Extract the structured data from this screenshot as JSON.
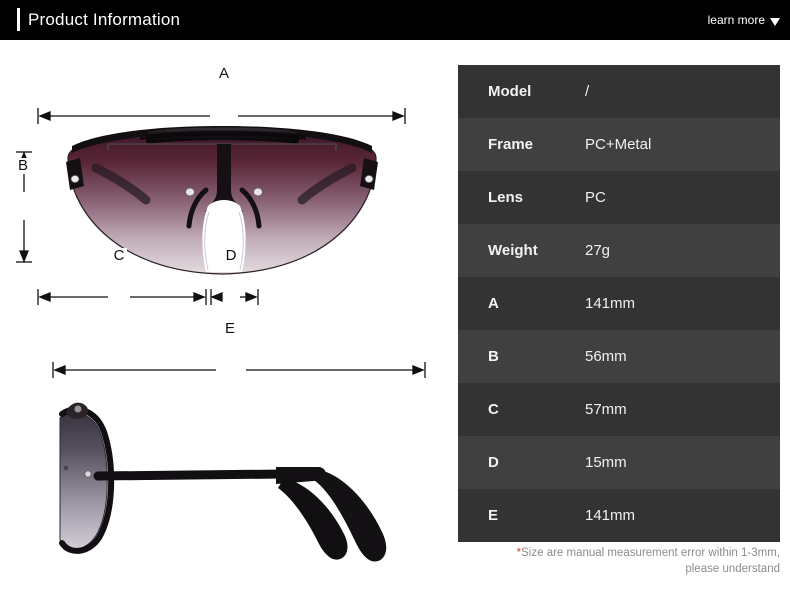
{
  "header": {
    "title": "Product Information",
    "learn_more_label": "learn more",
    "caret_icon": "chevron-down-icon",
    "background_color": "#000000",
    "text_color": "#ffffff"
  },
  "diagram": {
    "front_view": {
      "alt": "sunglasses-front-view",
      "lens_gradient_top": "#4a1f2e",
      "lens_gradient_bottom": "#e4dbe0",
      "frame_color": "#141014"
    },
    "side_view": {
      "alt": "sunglasses-side-view",
      "lens_gradient_top": "#3a3540",
      "lens_gradient_bottom": "#ded8e0",
      "frame_color": "#111111"
    },
    "dimension_labels": [
      {
        "id": "A",
        "label": "A",
        "orientation": "horizontal",
        "view": "front"
      },
      {
        "id": "B",
        "label": "B",
        "orientation": "vertical",
        "view": "front"
      },
      {
        "id": "C",
        "label": "C",
        "orientation": "horizontal",
        "view": "front"
      },
      {
        "id": "D",
        "label": "D",
        "orientation": "horizontal",
        "view": "front"
      },
      {
        "id": "E",
        "label": "E",
        "orientation": "horizontal",
        "view": "side"
      }
    ]
  },
  "spec_table": {
    "row_color_odd": "#333333",
    "row_color_even": "#404040",
    "rows": [
      {
        "key": "Model",
        "value": "/"
      },
      {
        "key": "Frame",
        "value": "PC+Metal"
      },
      {
        "key": "Lens",
        "value": "PC"
      },
      {
        "key": "Weight",
        "value": "27g"
      },
      {
        "key": "A",
        "value": "141mm"
      },
      {
        "key": "B",
        "value": "56mm"
      },
      {
        "key": "C",
        "value": "57mm"
      },
      {
        "key": "D",
        "value": "15mm"
      },
      {
        "key": "E",
        "value": "141mm"
      }
    ],
    "note_star": "*",
    "note_line1": "Size are manual measurement error within 1-3mm,",
    "note_line2": "please understand",
    "note_color": "#8c8c8c",
    "star_color": "#e03a3a"
  }
}
